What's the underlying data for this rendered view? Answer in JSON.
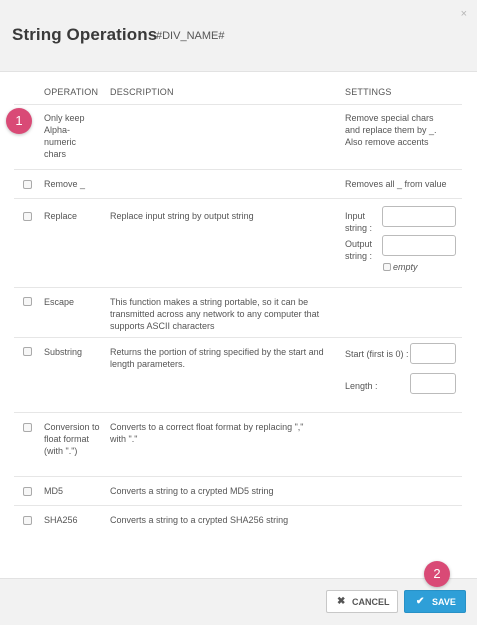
{
  "header": {
    "title": "String Operations",
    "subtitle": "#DIV_NAME#",
    "close_glyph": "×"
  },
  "table": {
    "columns": [
      "",
      "OPERATION",
      "DESCRIPTION",
      "SETTINGS"
    ],
    "rows": [
      {
        "operation": "Only keep Alpha-numeric chars",
        "description": "",
        "settings": "Remove special chars and replace them by _. Also remove accents"
      },
      {
        "operation": "Remove _",
        "description": "",
        "settings": "Removes all _ from value"
      },
      {
        "operation": "Replace",
        "description": "Replace input string by output string",
        "fields": [
          "Input string :",
          "Output string :"
        ],
        "empty_label": "empty"
      },
      {
        "operation": "Escape",
        "description": "This function makes a string portable, so it can be transmitted across any network to any computer that supports ASCII characters"
      },
      {
        "operation": "Substring",
        "description": "Returns the portion of string specified by the start and length parameters.",
        "fields": [
          "Start (first is 0) :",
          "Length :"
        ]
      },
      {
        "operation": "Conversion to float format (with \".\")",
        "description": "Converts to a correct float format by replacing \",\" with \".\""
      },
      {
        "operation": "MD5",
        "description": "Converts a string to a crypted MD5 string"
      },
      {
        "operation": "SHA256",
        "description": "Converts a string to a crypted SHA256 string"
      }
    ]
  },
  "badges": [
    "1",
    "2"
  ],
  "footer": {
    "cancel_label": "CANCEL",
    "save_label": "SAVE",
    "cancel_icon": "✖",
    "save_icon": "✔"
  },
  "colors": {
    "accent": "#2e9fd8",
    "badge": "#d94a76",
    "header_bg": "#f2f2f2"
  }
}
